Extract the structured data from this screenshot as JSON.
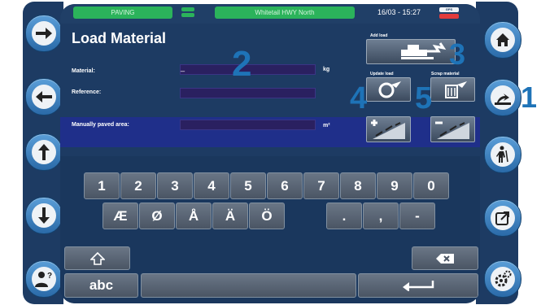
{
  "status": {
    "mode": "PAVING",
    "site": "Whitetail HWY North",
    "datetime": "16/03 - 15:27",
    "gps": "GPS"
  },
  "title": "Load Material",
  "form": {
    "material_label": "Material:",
    "material_value": "_",
    "material_unit": "kg",
    "reference_label": "Reference:",
    "paved_label": "Manually paved area:",
    "paved_unit": "m²"
  },
  "tools": {
    "add_load": "Add load",
    "update_load": "Update load",
    "scrap_material": "Scrap material"
  },
  "callouts": [
    "1",
    "2",
    "3",
    "4",
    "5"
  ],
  "keyboard": {
    "row1": [
      "1",
      "2",
      "3",
      "4",
      "5",
      "6",
      "7",
      "8",
      "9",
      "0"
    ],
    "row2_letters": [
      "Æ",
      "Ø",
      "Å",
      "Ä",
      "Ö"
    ],
    "row2_symbols": [
      ".",
      ",",
      "-"
    ],
    "abc": "abc"
  },
  "left_nav": [
    "arrow-right-icon",
    "arrow-left-icon",
    "arrow-up-icon",
    "arrow-down-icon",
    "user-help-icon"
  ],
  "right_nav": [
    "home-icon",
    "load-material-icon",
    "worker-icon",
    "export-icon",
    "settings-icon"
  ],
  "colors": {
    "background": "#1d3b63",
    "accent": "#1e73b7",
    "status_green": "#2bb35b"
  }
}
